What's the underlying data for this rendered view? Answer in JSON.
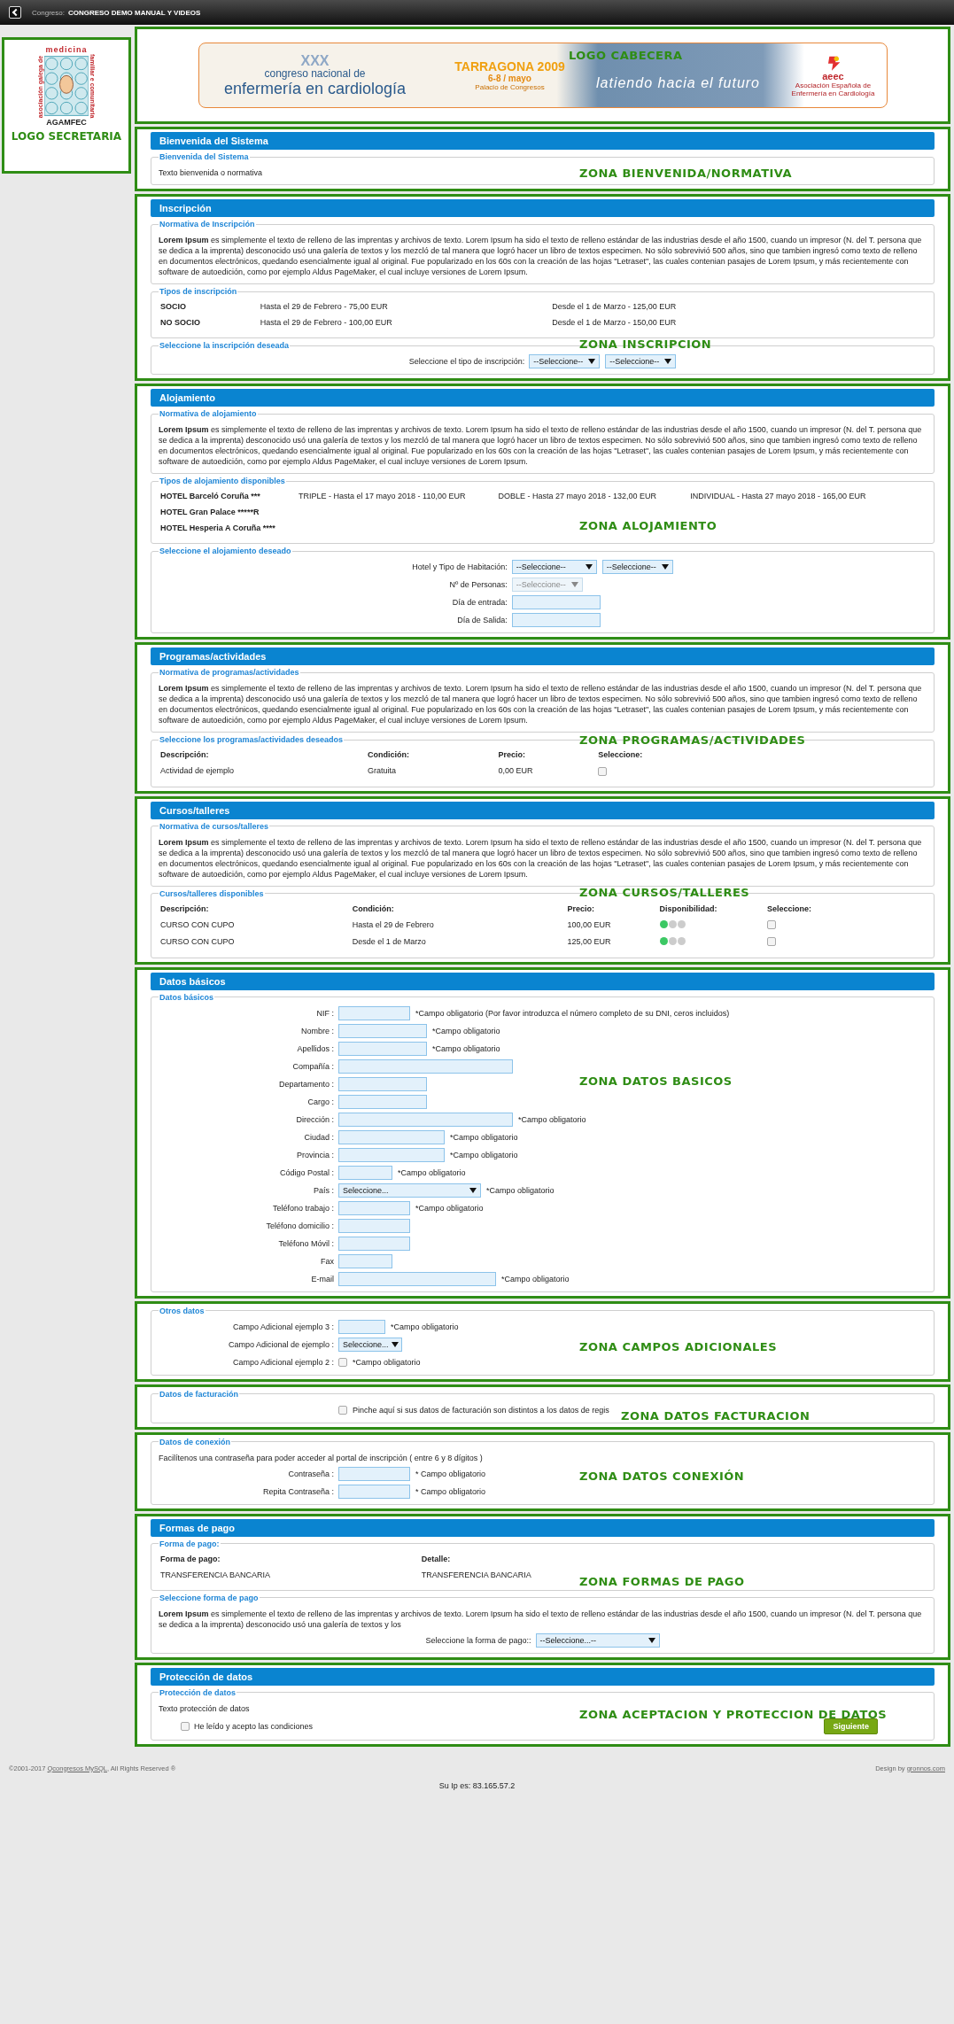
{
  "top_bar": {
    "label": "Congreso:",
    "title": "CONGRESO DEMO MANUAL Y VIDEOS"
  },
  "sidebar": {
    "logo": {
      "top_text": "medicina",
      "left_text": "asociación galega de",
      "right_text": "familiar e comunitaria",
      "name_text": "AGAMFEC"
    },
    "zone_label": "LOGO SECRETARIA"
  },
  "banner": {
    "zone_label": "LOGO CABECERA",
    "edition": "XXX",
    "line1": "congreso nacional de",
    "line2": "enfermería en cardiología",
    "city": "TARRAGONA 2009",
    "dates": "6-8 / mayo",
    "venue": "Palacio de Congresos",
    "slogan": "latiendo hacia el futuro",
    "org_logo": "aeec",
    "org_name": "Asociación Española de Enfermería en Cardiología"
  },
  "sections": [
    {
      "title": "Bienvenida del Sistema",
      "zone_label": "ZONA BIENVENIDA/NORMATIVA",
      "groups": [
        {
          "legend": "Bienvenida del Sistema",
          "blocks": [
            {
              "kind": "text",
              "text": "Texto bienvenida o normativa"
            }
          ]
        }
      ]
    },
    {
      "title": "Inscripción",
      "zone_label": "ZONA INSCRIPCION",
      "groups": [
        {
          "legend": "Normativa de Inscripción",
          "blocks": [
            {
              "kind": "text",
              "text": "**Lorem Ipsum** es simplemente el texto de relleno de las imprentas y archivos de texto. Lorem Ipsum ha sido el texto de relleno estándar de las industrias desde el año 1500, cuando un impresor (N. del T. persona que se dedica a la imprenta) desconocido usó una galería de textos y los mezcló de tal manera que logró hacer un libro de textos especimen. No sólo sobrevivió 500 años, sino que tambien ingresó como texto de relleno en documentos electrónicos, quedando esencialmente igual al original. Fue popularizado en los 60s con la creación de las hojas \"Letraset\", las cuales contenian pasajes de Lorem Ipsum, y más recientemente con software de autoedición, como por ejemplo Aldus PageMaker, el cual incluye versiones de Lorem Ipsum."
            }
          ]
        },
        {
          "legend": "Tipos de inscripción",
          "blocks": [
            {
              "kind": "table",
              "first_bold": true,
              "rows": [
                [
                  "SOCIO",
                  "Hasta el 29 de Febrero - 75,00 EUR",
                  "Desde el 1 de Marzo - 125,00 EUR"
                ],
                [
                  "NO SOCIO",
                  "Hasta el 29 de Febrero - 100,00 EUR",
                  "Desde el 1 de Marzo - 150,00 EUR"
                ]
              ]
            }
          ]
        },
        {
          "legend": "Seleccione la inscripción deseada",
          "blocks": [
            {
              "kind": "form",
              "centered": true,
              "rows": [
                {
                  "label": "Seleccione el tipo de inscripción:",
                  "controls": [
                    {
                      "kind": "select",
                      "value": "--Seleccione--",
                      "disabled": false
                    },
                    {
                      "kind": "select",
                      "value": "--Seleccione--",
                      "disabled": false
                    }
                  ]
                }
              ]
            }
          ]
        }
      ]
    },
    {
      "title": "Alojamiento",
      "zone_label": "ZONA ALOJAMIENTO",
      "groups": [
        {
          "legend": "Normativa de alojamiento",
          "blocks": [
            {
              "kind": "text",
              "text": "**Lorem Ipsum** es simplemente el texto de relleno de las imprentas y archivos de texto. Lorem Ipsum ha sido el texto de relleno estándar de las industrias desde el año 1500, cuando un impresor (N. del T. persona que se dedica a la imprenta) desconocido usó una galería de textos y los mezcló de tal manera que logró hacer un libro de textos especimen. No sólo sobrevivió 500 años, sino que tambien ingresó como texto de relleno en documentos electrónicos, quedando esencialmente igual al original. Fue popularizado en los 60s con la creación de las hojas \"Letraset\", las cuales contenian pasajes de Lorem Ipsum, y más recientemente con software de autoedición, como por ejemplo Aldus PageMaker, el cual incluye versiones de Lorem Ipsum."
            }
          ]
        },
        {
          "legend": "Tipos de alojamiento disponibles",
          "blocks": [
            {
              "kind": "table",
              "first_bold": true,
              "rows": [
                [
                  "HOTEL Barceló Coruña ***",
                  "TRIPLE - Hasta el 17 mayo 2018 - 110,00 EUR",
                  "DOBLE - Hasta 27 mayo 2018 - 132,00 EUR",
                  "INDIVIDUAL - Hasta 27 mayo 2018 - 165,00 EUR"
                ],
                [
                  "HOTEL Gran Palace *****R"
                ],
                [
                  "HOTEL Hesperia A Coruña ****"
                ]
              ]
            }
          ]
        },
        {
          "legend": "Seleccione el alojamiento deseado",
          "blocks": [
            {
              "kind": "form",
              "centered": true,
              "rows": [
                {
                  "label": "Hotel y Tipo de Habitación:",
                  "controls": [
                    {
                      "kind": "select",
                      "value": "--Seleccione--",
                      "disabled": false
                    },
                    {
                      "kind": "select",
                      "value": "--Seleccione--",
                      "disabled": false
                    }
                  ]
                },
                {
                  "label": "Nº de Personas:",
                  "controls": [
                    {
                      "kind": "select",
                      "value": "--Seleccione--",
                      "disabled": true
                    }
                  ]
                },
                {
                  "label": "Día de entrada:",
                  "controls": [
                    {
                      "kind": "input"
                    }
                  ]
                },
                {
                  "label": "Día de Salida:",
                  "controls": [
                    {
                      "kind": "input"
                    }
                  ]
                }
              ]
            }
          ]
        }
      ]
    },
    {
      "title": "Programas/actividades",
      "zone_label": "ZONA PROGRAMAS/ACTIVIDADES",
      "groups": [
        {
          "legend": "Normativa de programas/actividades",
          "blocks": [
            {
              "kind": "text",
              "text": "**Lorem Ipsum** es simplemente el texto de relleno de las imprentas y archivos de texto. Lorem Ipsum ha sido el texto de relleno estándar de las industrias desde el año 1500, cuando un impresor (N. del T. persona que se dedica a la imprenta) desconocido usó una galería de textos y los mezcló de tal manera que logró hacer un libro de textos especimen. No sólo sobrevivió 500 años, sino que tambien ingresó como texto de relleno en documentos electrónicos, quedando esencialmente igual al original. Fue popularizado en los 60s con la creación de las hojas \"Letraset\", las cuales contenian pasajes de Lorem Ipsum, y más recientemente con software de autoedición, como por ejemplo Aldus PageMaker, el cual incluye versiones de Lorem Ipsum."
            }
          ]
        },
        {
          "legend": "Seleccione los programas/actividades deseados",
          "blocks": [
            {
              "kind": "table",
              "first_bold": false,
              "header": [
                "Descripción:",
                "Condición:",
                "Precio:",
                "Seleccione:"
              ],
              "rows": [
                [
                  "Actividad de ejemplo",
                  "Gratuita",
                  "0,00 EUR",
                  {
                    "kind": "checkbox",
                    "checked": false
                  }
                ]
              ]
            }
          ]
        }
      ]
    },
    {
      "title": "Cursos/talleres",
      "zone_label": "ZONA CURSOS/TALLERES",
      "groups": [
        {
          "legend": "Normativa de cursos/talleres",
          "blocks": [
            {
              "kind": "text",
              "text": "**Lorem Ipsum** es simplemente el texto de relleno de las imprentas y archivos de texto. Lorem Ipsum ha sido el texto de relleno estándar de las industrias desde el año 1500, cuando un impresor (N. del T. persona que se dedica a la imprenta) desconocido usó una galería de textos y los mezcló de tal manera que logró hacer un libro de textos especimen. No sólo sobrevivió 500 años, sino que tambien ingresó como texto de relleno en documentos electrónicos, quedando esencialmente igual al original. Fue popularizado en los 60s con la creación de las hojas \"Letraset\", las cuales contenian pasajes de Lorem Ipsum, y más recientemente con software de autoedición, como por ejemplo Aldus PageMaker, el cual incluye versiones de Lorem Ipsum."
            }
          ]
        },
        {
          "legend": "Cursos/talleres disponibles",
          "blocks": [
            {
              "kind": "table",
              "first_bold": false,
              "header": [
                "Descripción:",
                "Condición:",
                "Precio:",
                "Disponibilidad:",
                "Seleccione:"
              ],
              "rows": [
                [
                  "CURSO CON CUPO",
                  "Hasta el 29 de Febrero",
                  "100,00 EUR",
                  {
                    "kind": "dots",
                    "dots": [
                      {
                        "color": "#3cc864"
                      },
                      {
                        "color": "#cccccc"
                      },
                      {
                        "color": "#cccccc"
                      }
                    ]
                  },
                  {
                    "kind": "checkbox",
                    "checked": false
                  }
                ],
                [
                  "CURSO CON CUPO",
                  "Desde el 1 de Marzo",
                  "125,00 EUR",
                  {
                    "kind": "dots",
                    "dots": [
                      {
                        "color": "#3cc864"
                      },
                      {
                        "color": "#cccccc"
                      },
                      {
                        "color": "#cccccc"
                      }
                    ]
                  },
                  {
                    "kind": "checkbox",
                    "checked": false
                  }
                ]
              ]
            }
          ]
        }
      ]
    },
    {
      "title": "Datos básicos",
      "zone_label": "ZONA DATOS BASICOS",
      "groups": [
        {
          "legend": "Datos básicos",
          "blocks": [
            {
              "kind": "form",
              "centered": false,
              "rows": [
                {
                  "label": "NIF :",
                  "controls": [
                    {
                      "kind": "input"
                    }
                  ],
                  "note": "*Campo obligatorio (Por favor introduzca el número completo de su DNI, ceros incluidos)"
                },
                {
                  "label": "Nombre :",
                  "controls": [
                    {
                      "kind": "input"
                    }
                  ],
                  "note": "*Campo obligatorio"
                },
                {
                  "label": "Apellidos :",
                  "controls": [
                    {
                      "kind": "input"
                    }
                  ],
                  "note": "*Campo obligatorio"
                },
                {
                  "label": "Compañía :",
                  "controls": [
                    {
                      "kind": "input"
                    }
                  ]
                },
                {
                  "label": "Departamento :",
                  "controls": [
                    {
                      "kind": "input"
                    }
                  ]
                },
                {
                  "label": "Cargo :",
                  "controls": [
                    {
                      "kind": "input"
                    }
                  ]
                },
                {
                  "label": "Dirección :",
                  "controls": [
                    {
                      "kind": "input"
                    }
                  ],
                  "note": "*Campo obligatorio"
                },
                {
                  "label": "Ciudad :",
                  "controls": [
                    {
                      "kind": "input"
                    }
                  ],
                  "note": "*Campo obligatorio"
                },
                {
                  "label": "Provincia :",
                  "controls": [
                    {
                      "kind": "input"
                    }
                  ],
                  "note": "*Campo obligatorio"
                },
                {
                  "label": "Código Postal :",
                  "controls": [
                    {
                      "kind": "input"
                    }
                  ],
                  "note": "*Campo obligatorio"
                },
                {
                  "label": "País :",
                  "controls": [
                    {
                      "kind": "select",
                      "value": "Seleccione...",
                      "disabled": false
                    }
                  ],
                  "note": "*Campo obligatorio"
                },
                {
                  "label": "Teléfono trabajo :",
                  "controls": [
                    {
                      "kind": "input"
                    }
                  ],
                  "note": "*Campo obligatorio"
                },
                {
                  "label": "Teléfono domicilio :",
                  "controls": [
                    {
                      "kind": "input"
                    }
                  ]
                },
                {
                  "label": "Teléfono Móvil :",
                  "controls": [
                    {
                      "kind": "input"
                    }
                  ]
                },
                {
                  "label": "Fax",
                  "controls": [
                    {
                      "kind": "input"
                    }
                  ]
                },
                {
                  "label": "E-mail",
                  "controls": [
                    {
                      "kind": "input"
                    }
                  ],
                  "note": "*Campo obligatorio"
                }
              ]
            }
          ]
        }
      ]
    },
    {
      "zone_label": "ZONA CAMPOS ADICIONALES",
      "groups": [
        {
          "legend": "Otros datos",
          "blocks": [
            {
              "kind": "form",
              "centered": false,
              "rows": [
                {
                  "label": "Campo Adicional ejemplo 3 :",
                  "controls": [
                    {
                      "kind": "input"
                    }
                  ],
                  "note": "*Campo obligatorio"
                },
                {
                  "label": "Campo Adicional de ejemplo :",
                  "controls": [
                    {
                      "kind": "select",
                      "value": "Seleccione...",
                      "disabled": false
                    }
                  ]
                },
                {
                  "label": "Campo Adicional ejemplo 2 :",
                  "controls": [
                    {
                      "kind": "checkbox",
                      "checked": false
                    }
                  ],
                  "note": "*Campo obligatorio"
                }
              ]
            }
          ]
        }
      ]
    },
    {
      "zone_label": "ZONA DATOS FACTURACION",
      "groups": [
        {
          "legend": "Datos de facturación",
          "blocks": [
            {
              "kind": "form",
              "centered": false,
              "rows": [
                {
                  "controls": [
                    {
                      "kind": "checkbox",
                      "checked": false
                    }
                  ],
                  "note": "Pinche aquí si sus datos de facturación son distintos a los datos de regis"
                }
              ]
            }
          ]
        }
      ]
    },
    {
      "zone_label": "ZONA DATOS CONEXIÓN",
      "groups": [
        {
          "legend": "Datos de conexión",
          "blocks": [
            {
              "kind": "text",
              "text": "Facilítenos una contraseña para poder acceder al portal de inscripción ( entre 6 y 8 dígitos )"
            },
            {
              "kind": "form",
              "centered": false,
              "rows": [
                {
                  "label": "Contraseña :",
                  "controls": [
                    {
                      "kind": "input"
                    }
                  ],
                  "note": "* Campo obligatorio"
                },
                {
                  "label": "Repita Contraseña :",
                  "controls": [
                    {
                      "kind": "input"
                    }
                  ],
                  "note": "* Campo obligatorio"
                }
              ]
            }
          ]
        }
      ]
    },
    {
      "title": "Formas de pago",
      "zone_label": "ZONA FORMAS DE PAGO",
      "groups": [
        {
          "legend": "Forma de pago:",
          "blocks": [
            {
              "kind": "table",
              "first_bold": false,
              "header": [
                "Forma de pago:",
                "Detalle:"
              ],
              "rows": [
                [
                  "TRANSFERENCIA BANCARIA",
                  "TRANSFERENCIA BANCARIA"
                ]
              ]
            }
          ]
        },
        {
          "legend": "Seleccione forma de pago",
          "blocks": [
            {
              "kind": "text",
              "text": "**Lorem Ipsum** es simplemente el texto de relleno de las imprentas y archivos de texto. Lorem Ipsum ha sido el texto de relleno estándar de las industrias desde el año 1500, cuando un impresor (N. del T. persona que se dedica a la imprenta) desconocido usó una galería de textos y los"
            },
            {
              "kind": "form",
              "centered": true,
              "rows": [
                {
                  "label": "Seleccione la forma de pago::",
                  "controls": [
                    {
                      "kind": "select",
                      "value": "--Seleccione...--",
                      "disabled": false
                    }
                  ]
                }
              ]
            }
          ]
        }
      ]
    },
    {
      "title": "Protección de datos",
      "zone_label": "ZONA ACEPTACION Y PROTECCION DE DATOS",
      "groups": [
        {
          "legend": "Protección de datos",
          "blocks": [
            {
              "kind": "text",
              "text": "Texto protección de datos"
            },
            {
              "kind": "accept",
              "label": "He leído y acepto las condiciones",
              "checked": false,
              "button": "Siguiente"
            }
          ]
        }
      ]
    }
  ],
  "footer": {
    "copyright_prefix": "©2001-2017",
    "copyright_link": "Qcongresos MySQL",
    "copyright_suffix": ", All Rights Reserved ®",
    "design_prefix": "Design by",
    "design_link": "gronnos.com",
    "ip_text": "Su Ip es: 83.165.57.2"
  }
}
